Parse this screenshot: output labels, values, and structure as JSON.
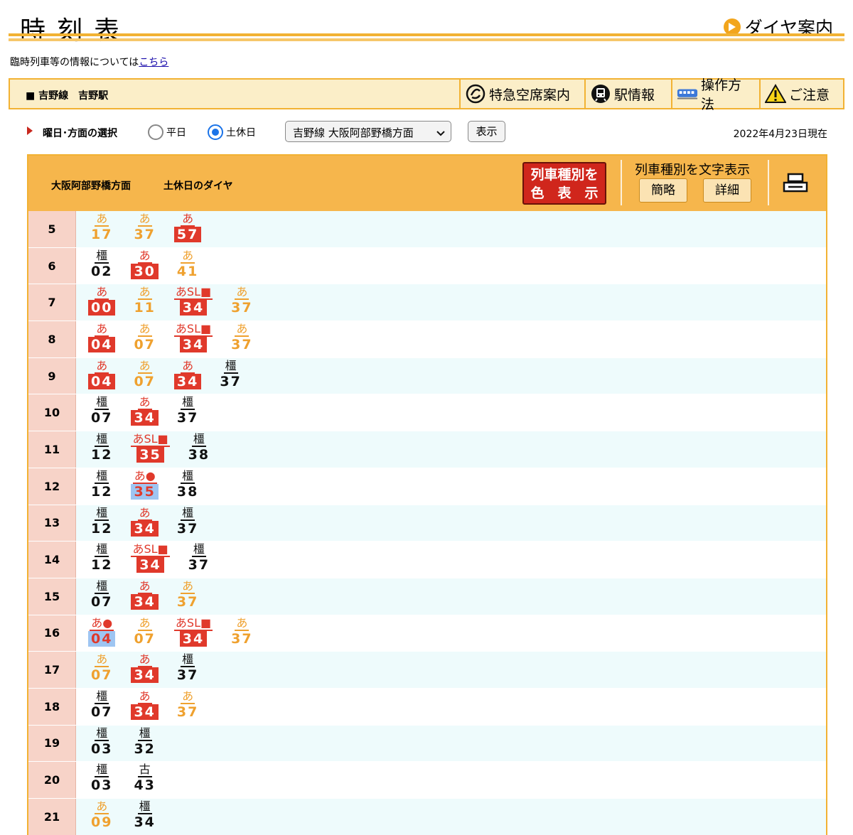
{
  "header": {
    "title": "時刻表",
    "dia_link": "ダイヤ案内",
    "info_text": "臨時列車等の情報については",
    "info_link": "こちら"
  },
  "station": {
    "name": "■ 吉野線　吉野駅",
    "tools": [
      {
        "label": "特急空席案内",
        "icon": "reservation-icon"
      },
      {
        "label": "駅情報",
        "icon": "train-front-icon"
      },
      {
        "label": "操作方法",
        "icon": "train-side-icon"
      },
      {
        "label": "ご注意",
        "icon": "warning-icon"
      }
    ]
  },
  "selection": {
    "label": "曜日･方面の選択",
    "options": [
      {
        "label": "平日",
        "selected": false
      },
      {
        "label": "土休日",
        "selected": true
      }
    ],
    "direction": "吉野線 大阪阿部野橋方面",
    "show_button": "表示",
    "as_of": "2022年4月23日現在"
  },
  "timetable": {
    "direction": "大阪阿部野橋方面",
    "day_type": "土休日のダイヤ",
    "color_button_line1": "列車種別を",
    "color_button_line2": "色　表　示",
    "text_display_title": "列車種別を文字表示",
    "text_btn_simple": "簡略",
    "text_btn_detail": "詳細",
    "print_icon": "print-icon",
    "colors": {
      "orange": "#efa12f",
      "red": "#e0392b",
      "blue": "#9ec5f2",
      "hour_bg": "#f7d3c8"
    },
    "rows": [
      {
        "hour": "5",
        "deps": [
          {
            "dest": "あ",
            "min": "17",
            "style": "orange"
          },
          {
            "dest": "あ",
            "min": "37",
            "style": "orange"
          },
          {
            "dest": "あ",
            "min": "57",
            "style": "red"
          }
        ]
      },
      {
        "hour": "6",
        "deps": [
          {
            "dest": "橿",
            "min": "02",
            "style": "black"
          },
          {
            "dest": "あ",
            "min": "30",
            "style": "red"
          },
          {
            "dest": "あ",
            "min": "41",
            "style": "orange"
          }
        ]
      },
      {
        "hour": "7",
        "deps": [
          {
            "dest": "あ",
            "min": "00",
            "style": "red"
          },
          {
            "dest": "あ",
            "min": "11",
            "style": "orange"
          },
          {
            "dest": "あSL■",
            "min": "34",
            "style": "red"
          },
          {
            "dest": "あ",
            "min": "37",
            "style": "orange"
          }
        ]
      },
      {
        "hour": "8",
        "deps": [
          {
            "dest": "あ",
            "min": "04",
            "style": "red"
          },
          {
            "dest": "あ",
            "min": "07",
            "style": "orange"
          },
          {
            "dest": "あSL■",
            "min": "34",
            "style": "red"
          },
          {
            "dest": "あ",
            "min": "37",
            "style": "orange"
          }
        ]
      },
      {
        "hour": "9",
        "deps": [
          {
            "dest": "あ",
            "min": "04",
            "style": "red"
          },
          {
            "dest": "あ",
            "min": "07",
            "style": "orange"
          },
          {
            "dest": "あ",
            "min": "34",
            "style": "red"
          },
          {
            "dest": "橿",
            "min": "37",
            "style": "black"
          }
        ]
      },
      {
        "hour": "10",
        "deps": [
          {
            "dest": "橿",
            "min": "07",
            "style": "black"
          },
          {
            "dest": "あ",
            "min": "34",
            "style": "red"
          },
          {
            "dest": "橿",
            "min": "37",
            "style": "black"
          }
        ]
      },
      {
        "hour": "11",
        "deps": [
          {
            "dest": "橿",
            "min": "12",
            "style": "black"
          },
          {
            "dest": "あSL■",
            "min": "35",
            "style": "red"
          },
          {
            "dest": "橿",
            "min": "38",
            "style": "black"
          }
        ]
      },
      {
        "hour": "12",
        "deps": [
          {
            "dest": "橿",
            "min": "12",
            "style": "black"
          },
          {
            "dest": "あ●",
            "min": "35",
            "style": "blue"
          },
          {
            "dest": "橿",
            "min": "38",
            "style": "black"
          }
        ]
      },
      {
        "hour": "13",
        "deps": [
          {
            "dest": "橿",
            "min": "12",
            "style": "black"
          },
          {
            "dest": "あ",
            "min": "34",
            "style": "red"
          },
          {
            "dest": "橿",
            "min": "37",
            "style": "black"
          }
        ]
      },
      {
        "hour": "14",
        "deps": [
          {
            "dest": "橿",
            "min": "12",
            "style": "black"
          },
          {
            "dest": "あSL■",
            "min": "34",
            "style": "red"
          },
          {
            "dest": "橿",
            "min": "37",
            "style": "black"
          }
        ]
      },
      {
        "hour": "15",
        "deps": [
          {
            "dest": "橿",
            "min": "07",
            "style": "black"
          },
          {
            "dest": "あ",
            "min": "34",
            "style": "red"
          },
          {
            "dest": "あ",
            "min": "37",
            "style": "orange"
          }
        ]
      },
      {
        "hour": "16",
        "deps": [
          {
            "dest": "あ●",
            "min": "04",
            "style": "blue"
          },
          {
            "dest": "あ",
            "min": "07",
            "style": "orange"
          },
          {
            "dest": "あSL■",
            "min": "34",
            "style": "red"
          },
          {
            "dest": "あ",
            "min": "37",
            "style": "orange"
          }
        ]
      },
      {
        "hour": "17",
        "deps": [
          {
            "dest": "あ",
            "min": "07",
            "style": "orange"
          },
          {
            "dest": "あ",
            "min": "34",
            "style": "red"
          },
          {
            "dest": "橿",
            "min": "37",
            "style": "black"
          }
        ]
      },
      {
        "hour": "18",
        "deps": [
          {
            "dest": "橿",
            "min": "07",
            "style": "black"
          },
          {
            "dest": "あ",
            "min": "34",
            "style": "red"
          },
          {
            "dest": "あ",
            "min": "37",
            "style": "orange"
          }
        ]
      },
      {
        "hour": "19",
        "deps": [
          {
            "dest": "橿",
            "min": "03",
            "style": "black"
          },
          {
            "dest": "橿",
            "min": "32",
            "style": "black"
          }
        ]
      },
      {
        "hour": "20",
        "deps": [
          {
            "dest": "橿",
            "min": "03",
            "style": "black"
          },
          {
            "dest": "古",
            "min": "43",
            "style": "black"
          }
        ]
      },
      {
        "hour": "21",
        "deps": [
          {
            "dest": "あ",
            "min": "09",
            "style": "orange"
          },
          {
            "dest": "橿",
            "min": "34",
            "style": "black"
          }
        ]
      }
    ]
  }
}
